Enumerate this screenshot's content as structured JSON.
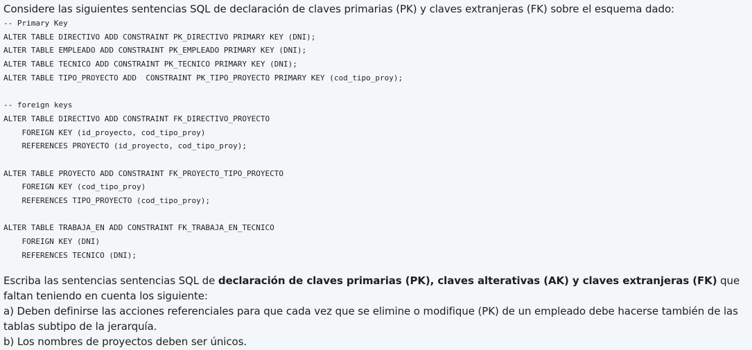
{
  "intro": "Considere las siguientes sentencias SQL de declaración de claves primarias (PK) y claves extranjeras (FK) sobre el esquema dado:",
  "code_lines": [
    "-- Primary Key",
    "ALTER TABLE DIRECTIVO ADD CONSTRAINT PK_DIRECTIVO PRIMARY KEY (DNI);",
    "ALTER TABLE EMPLEADO ADD CONSTRAINT PK_EMPLEADO PRIMARY KEY (DNI);",
    "ALTER TABLE TECNICO ADD CONSTRAINT PK_TECNICO PRIMARY KEY (DNI);",
    "ALTER TABLE TIPO_PROYECTO ADD  CONSTRAINT PK_TIPO_PROYECTO PRIMARY KEY (cod_tipo_proy);",
    "",
    "-- foreign keys",
    "ALTER TABLE DIRECTIVO ADD CONSTRAINT FK_DIRECTIVO_PROYECTO",
    "    FOREIGN KEY (id_proyecto, cod_tipo_proy)",
    "    REFERENCES PROYECTO (id_proyecto, cod_tipo_proy);",
    "",
    "ALTER TABLE PROYECTO ADD CONSTRAINT FK_PROYECTO_TIPO_PROYECTO",
    "    FOREIGN KEY (cod_tipo_proy)",
    "    REFERENCES TIPO_PROYECTO (cod_tipo_proy);",
    "",
    "ALTER TABLE TRABAJA_EN ADD CONSTRAINT FK_TRABAJA_EN_TECNICO",
    "    FOREIGN KEY (DNI)",
    "    REFERENCES TECNICO (DNI);"
  ],
  "task": {
    "prefix": "Escriba las sentencias sentencias SQL de ",
    "bold": "declaración de claves primarias (PK), claves alterativas (AK) y claves extranjeras (FK)",
    "suffix": " que faltan teniendo en cuenta los siguiente:",
    "item_a": "a) Deben definirse las acciones referenciales para que cada vez que se elimine o modifique (PK) de un empleado debe hacerse también de las tablas subtipo de la jerarquía.",
    "item_b": "b) Los nombres de proyectos deben ser únicos."
  }
}
